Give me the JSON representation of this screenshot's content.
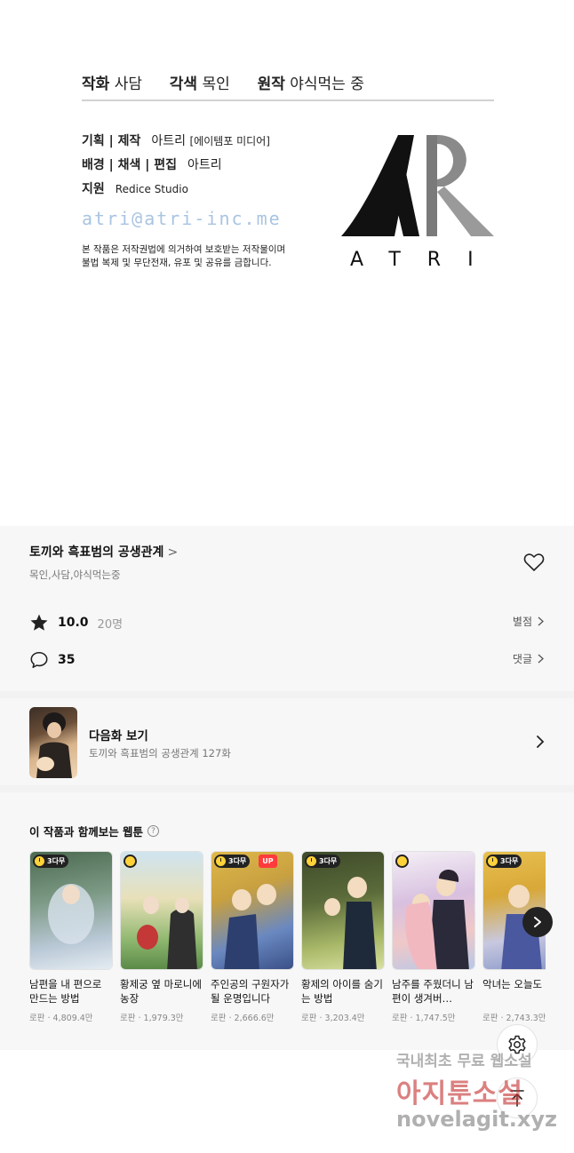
{
  "credits": {
    "art_label": "작화",
    "art_name": "사담",
    "adapt_label": "각색",
    "adapt_name": "목인",
    "original_label": "원작",
    "original_name": "야식먹는 중",
    "planning_label": "기획 | 제작",
    "planning_name": "아트리",
    "planning_sub": "[에이템포 미디어]",
    "bg_label": "배경 | 채색 | 편집",
    "bg_name": "아트리",
    "support_label": "지원",
    "support_name": "Redice Studio",
    "email": "atri@atri-inc.me",
    "notice_line1": "본 작품은 저작권법에 의거하여 보호받는 저작물이며",
    "notice_line2": "불법 복제 및 무단전재, 유포 및 공유를 금합니다.",
    "logo_text": "ATRI"
  },
  "series": {
    "title": "토끼와 흑표범의 공생관계",
    "title_chevron": ">",
    "authors": "목인,사담,야식먹는중",
    "favorite_icon": "heart-outline-icon"
  },
  "rating": {
    "icon": "star-icon",
    "score": "10.0",
    "count": "20명",
    "link": "별점"
  },
  "comments": {
    "icon": "speech-bubble-icon",
    "count": "35",
    "link": "댓글"
  },
  "next_episode": {
    "label": "다음화 보기",
    "subtitle": "토끼와 흑표범의 공생관계 127화"
  },
  "recommendations": {
    "heading": "이 작품과 함께보는 웹툰",
    "help_icon": "?",
    "items": [
      {
        "badge": "3다무",
        "up": "",
        "title": "남편을 내 편으로 만드는 방법",
        "meta": "로판 · 4,809.4만",
        "colors": [
          "#5f7a5e",
          "#b9c8d6"
        ]
      },
      {
        "badge": "",
        "up": "",
        "title": "황제궁 옆 마로니에 농장",
        "meta": "로판 · 1,979.3만",
        "colors": [
          "#8fb870",
          "#e8d9a8"
        ]
      },
      {
        "badge": "3다무",
        "up": "UP",
        "title": "주인공의 구원자가 될 운명입니다",
        "meta": "로판 · 2,666.6만",
        "colors": [
          "#c8a040",
          "#4a6aa8"
        ]
      },
      {
        "badge": "3다무",
        "up": "",
        "title": "황제의 아이를 숨기는 방법",
        "meta": "로판 · 3,203.4만",
        "colors": [
          "#5b6b3a",
          "#c2d07a"
        ]
      },
      {
        "badge": "",
        "up": "",
        "title": "남주를 주웠더니 남편이 생겨버…",
        "meta": "로판 · 1,747.5만",
        "colors": [
          "#c8b0d8",
          "#f0c8c8"
        ]
      },
      {
        "badge": "3다무",
        "up": "",
        "title": "악녀는 오늘도 겁다",
        "meta": "로판 · 2,743.3만",
        "colors": [
          "#d8a838",
          "#b8c8e8"
        ]
      }
    ]
  },
  "watermark": {
    "line1": "국내최초 무료 웹소설",
    "line2": "아지툰소설",
    "line3": "novelagit.xyz"
  }
}
